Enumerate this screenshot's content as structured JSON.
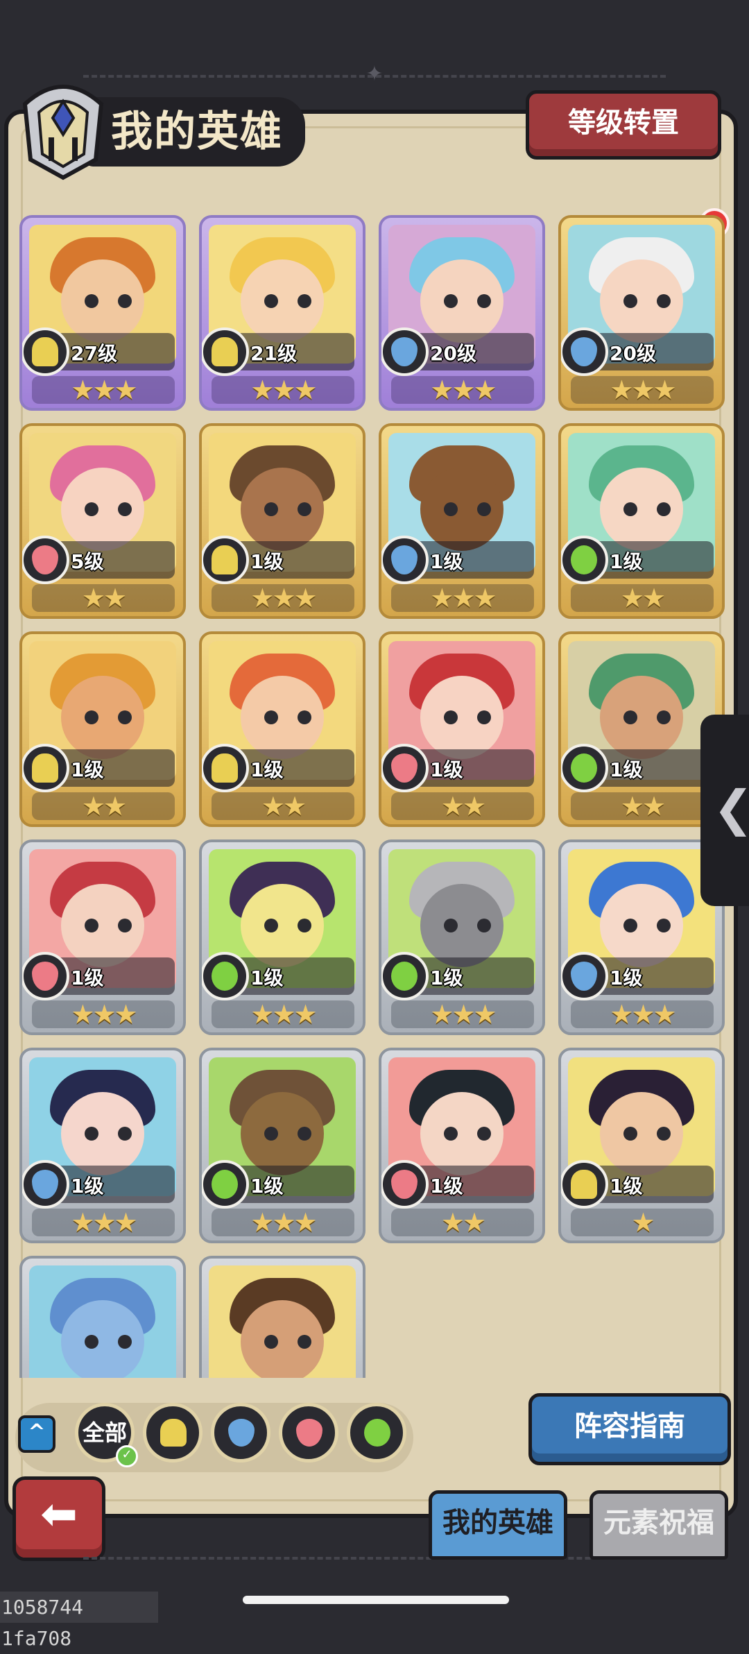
{
  "header": {
    "title": "我的英雄",
    "level_transfer_label": "等级转置"
  },
  "heroes": [
    {
      "level": "27级",
      "stars": "★★★",
      "element": "earth",
      "rarity": "purple",
      "bg": "#f2d77a",
      "hair": "#d7782e",
      "skin": "#f1c89f"
    },
    {
      "level": "21级",
      "stars": "★★★",
      "element": "earth",
      "rarity": "purple",
      "bg": "#f4de86",
      "hair": "#f2c850",
      "skin": "#f6d3b3"
    },
    {
      "level": "20级",
      "stars": "★★★",
      "element": "water",
      "rarity": "purple",
      "bg": "#d6a9d6",
      "hair": "#7fc8e6",
      "skin": "#f5d4bf"
    },
    {
      "level": "20级",
      "stars": "★★★",
      "element": "water",
      "rarity": "gold",
      "bg": "#9ed8e0",
      "hair": "#efefef",
      "skin": "#f6d6c2"
    },
    {
      "level": "5级",
      "stars": "★★",
      "element": "fire",
      "rarity": "gold",
      "bg": "#f1d780",
      "hair": "#e16f9c",
      "skin": "#f7d3c1"
    },
    {
      "level": "1级",
      "stars": "★★★",
      "element": "earth",
      "rarity": "gold",
      "bg": "#f3d87c",
      "hair": "#6b4a2e",
      "skin": "#a9744d"
    },
    {
      "level": "1级",
      "stars": "★★★",
      "element": "water",
      "rarity": "gold",
      "bg": "#a9dde8",
      "hair": "#8a5a33",
      "skin": "#8a5a33"
    },
    {
      "level": "1级",
      "stars": "★★",
      "element": "wood",
      "rarity": "gold",
      "bg": "#9fe0c8",
      "hair": "#5bb58d",
      "skin": "#f6d7c4"
    },
    {
      "level": "1级",
      "stars": "★★",
      "element": "earth",
      "rarity": "gold",
      "bg": "#f2d27c",
      "hair": "#e39b35",
      "skin": "#e8a873"
    },
    {
      "level": "1级",
      "stars": "★★",
      "element": "earth",
      "rarity": "gold",
      "bg": "#f3d97e",
      "hair": "#e46a3a",
      "skin": "#f4caa7"
    },
    {
      "level": "1级",
      "stars": "★★",
      "element": "fire",
      "rarity": "gold",
      "bg": "#f0a0a0",
      "hair": "#c9373a",
      "skin": "#f7d3c3"
    },
    {
      "level": "1级",
      "stars": "★★",
      "element": "wood",
      "rarity": "gold",
      "bg": "#d7cfa5",
      "hair": "#4f9a6b",
      "skin": "#d8a27a"
    },
    {
      "level": "1级",
      "stars": "★★★",
      "element": "fire",
      "rarity": "silver",
      "bg": "#f3a7a4",
      "hair": "#c53b43",
      "skin": "#f4d2c0"
    },
    {
      "level": "1级",
      "stars": "★★★",
      "element": "wood",
      "rarity": "silver",
      "bg": "#b7e46e",
      "hair": "#3f2f55",
      "skin": "#f1e58c"
    },
    {
      "level": "1级",
      "stars": "★★★",
      "element": "wood",
      "rarity": "silver",
      "bg": "#bfe07a",
      "hair": "#b6b6b9",
      "skin": "#8c8c90"
    },
    {
      "level": "1级",
      "stars": "★★★",
      "element": "water",
      "rarity": "silver",
      "bg": "#f3e17c",
      "hair": "#3d78d2",
      "skin": "#f6d9c9"
    },
    {
      "level": "1级",
      "stars": "★★★",
      "element": "water",
      "rarity": "silver",
      "bg": "#8fd2e6",
      "hair": "#262a4f",
      "skin": "#f5d6cc"
    },
    {
      "level": "1级",
      "stars": "★★★",
      "element": "wood",
      "rarity": "silver",
      "bg": "#a8d76b",
      "hair": "#6f5238",
      "skin": "#8d6a3e"
    },
    {
      "level": "1级",
      "stars": "★★",
      "element": "fire",
      "rarity": "silver",
      "bg": "#f29b97",
      "hair": "#21282f",
      "skin": "#f4d6c5"
    },
    {
      "level": "1级",
      "stars": "★",
      "element": "earth",
      "rarity": "silver",
      "bg": "#f1e07f",
      "hair": "#2a2035",
      "skin": "#efc7a3"
    },
    {
      "level": "",
      "stars": "",
      "element": "",
      "rarity": "silver",
      "bg": "#8fd0e4",
      "hair": "#5f8fcf",
      "skin": "#8fb8e4"
    },
    {
      "level": "",
      "stars": "",
      "element": "",
      "rarity": "silver",
      "bg": "#f1dc86",
      "hair": "#5a3b24",
      "skin": "#d59f77"
    }
  ],
  "filters": {
    "all_label": "全部",
    "collapse_icon": "^",
    "elements": [
      "earth",
      "water",
      "fire",
      "wood"
    ]
  },
  "buttons": {
    "team_guide_label": "阵容指南",
    "back_icon": "⬅"
  },
  "tabs": {
    "my_heroes": "我的英雄",
    "element_blessing": "元素祝福"
  },
  "side_tab_icon": "❮",
  "footer": {
    "id_text": "1058744 1fa708"
  },
  "colors": {
    "earth": "#e9cf53",
    "water": "#6aa6de",
    "fire": "#ec7b86",
    "wood": "#7fd042"
  }
}
